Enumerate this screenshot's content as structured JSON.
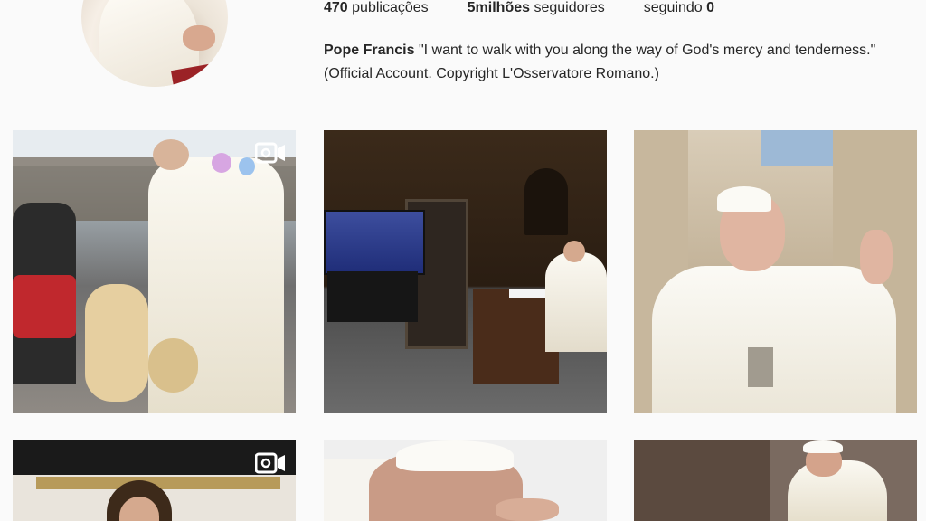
{
  "profile": {
    "posts_count": "470",
    "posts_label": "publicações",
    "followers_count": "5milhões",
    "followers_label": "seguidores",
    "following_label": "seguindo",
    "following_count": "0",
    "bio_name": "Pope Francis",
    "bio_line1": "\"I want to walk with you along the way of God's mercy and tenderness.\"",
    "bio_line2": "(Official Account. Copyright L'Osservatore Romano.)"
  },
  "grid": {
    "posts": [
      {
        "type": "video",
        "icon": "video-camera-icon"
      },
      {
        "type": "photo"
      },
      {
        "type": "photo"
      },
      {
        "type": "video",
        "icon": "video-camera-icon"
      },
      {
        "type": "photo"
      },
      {
        "type": "photo"
      }
    ]
  },
  "colors": {
    "background": "#fafafa",
    "text": "#262626"
  }
}
